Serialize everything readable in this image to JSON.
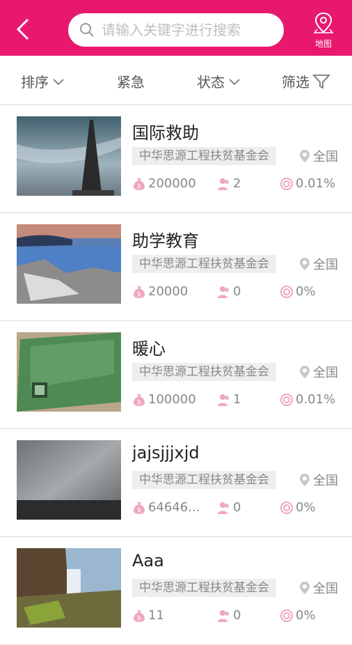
{
  "header": {
    "search_placeholder": "请输入关键字进行搜索",
    "map_label": "地图"
  },
  "filters": {
    "sort": "排序",
    "urgent": "紧急",
    "status": "状态",
    "filter": "筛选"
  },
  "items": [
    {
      "title": "国际救助",
      "org": "中华思源工程扶贫基金会",
      "location": "全国",
      "amount": "200000",
      "people": "2",
      "percent": "0.01%"
    },
    {
      "title": "助学教育",
      "org": "中华思源工程扶贫基金会",
      "location": "全国",
      "amount": "20000",
      "people": "0",
      "percent": "0%"
    },
    {
      "title": "暖心",
      "org": "中华思源工程扶贫基金会",
      "location": "全国",
      "amount": "100000",
      "people": "1",
      "percent": "0.01%"
    },
    {
      "title": "jajsjjjxjd",
      "org": "中华思源工程扶贫基金会",
      "location": "全国",
      "amount": "64646...",
      "people": "0",
      "percent": "0%"
    },
    {
      "title": "Aaa",
      "org": "中华思源工程扶贫基金会",
      "location": "全国",
      "amount": "11",
      "people": "0",
      "percent": "0%"
    }
  ]
}
